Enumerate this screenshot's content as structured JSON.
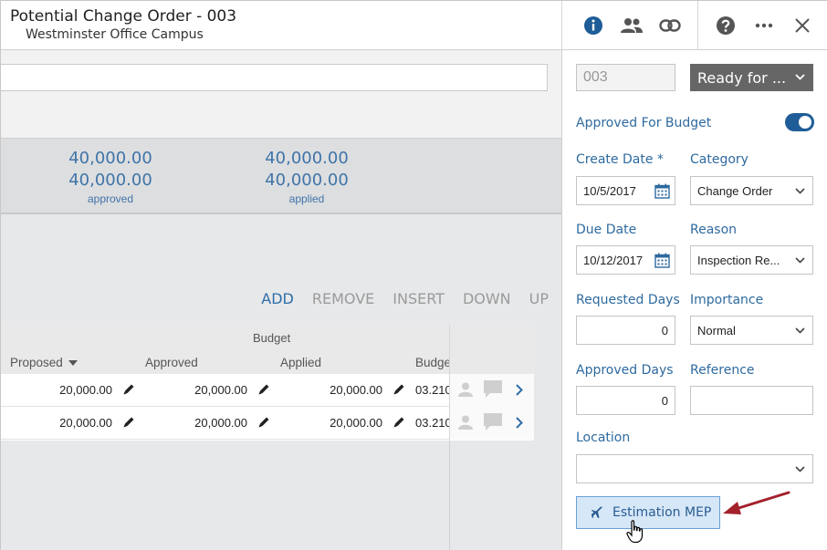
{
  "header": {
    "title": "Potential Change Order - 003",
    "subtitle": "Westminster Office Campus",
    "icons": [
      "info-icon",
      "people-icon",
      "link-icon",
      "help-icon",
      "more-icon",
      "close-icon"
    ]
  },
  "totals": [
    {
      "value1": "40,000.00",
      "value2": "40,000.00",
      "label": "approved"
    },
    {
      "value1": "40,000.00",
      "value2": "40,000.00",
      "label": "applied"
    }
  ],
  "actions": [
    "ADD",
    "REMOVE",
    "INSERT",
    "DOWN",
    "UP"
  ],
  "grid": {
    "group_header": "Budget",
    "columns": [
      "Proposed",
      "Approved",
      "Applied",
      "Budge"
    ],
    "rows": [
      {
        "proposed": "20,000.00",
        "approved": "20,000.00",
        "applied": "20,000.00",
        "code": "03.210"
      },
      {
        "proposed": "20,000.00",
        "approved": "20,000.00",
        "applied": "20,000.00",
        "code": "03.210"
      }
    ]
  },
  "form": {
    "number": "003",
    "status": "Ready for ...",
    "approved_for_budget_label": "Approved For Budget",
    "approved_for_budget": true,
    "create_date_label": "Create Date *",
    "create_date": "10/5/2017",
    "category_label": "Category",
    "category": "Change Order",
    "due_date_label": "Due Date",
    "due_date": "10/12/2017",
    "reason_label": "Reason",
    "reason": "Inspection Re...",
    "requested_days_label": "Requested Days",
    "requested_days": "0",
    "importance_label": "Importance",
    "importance": "Normal",
    "approved_days_label": "Approved Days",
    "approved_days": "0",
    "reference_label": "Reference",
    "reference": "",
    "location_label": "Location",
    "location": "",
    "estimation_button": "Estimation MEP"
  },
  "colors": {
    "accent": "#2e6a9f",
    "status_bg": "#666666",
    "toggle_on": "#1f5d98",
    "arrow": "#a3212b",
    "button_bg": "#d6e7f7"
  }
}
